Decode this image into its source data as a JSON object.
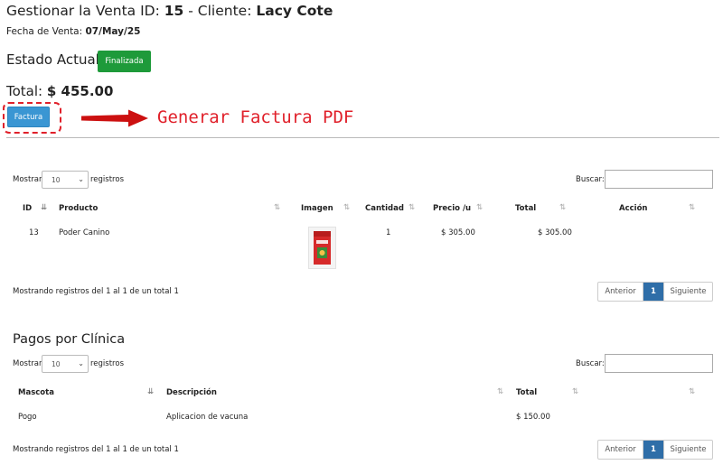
{
  "header": {
    "title_prefix": "Gestionar la Venta ID: ",
    "sale_id": "15",
    "title_mid": " - Cliente: ",
    "client": "Lacy Cote",
    "fecha_label": "Fecha de Venta: ",
    "fecha_value": "07/May/25",
    "estado_label": "Estado Actual:",
    "estado_value": "Finalizada",
    "total_label": "Total: ",
    "total_value": "$ 455.00",
    "factura_button": "Factura",
    "annotation": "Generar Factura PDF"
  },
  "sales_table": {
    "show_label": "Mostrar",
    "show_value": "10",
    "records_label": "registros",
    "search_label": "Buscar:",
    "columns": [
      "ID",
      "Producto",
      "Imagen",
      "Cantidad",
      "Precio /u",
      "Total",
      "Acción"
    ],
    "rows": [
      {
        "id": "13",
        "producto": "Poder Canino",
        "cantidad": "1",
        "precio": "$ 305.00",
        "total": "$ 305.00"
      }
    ],
    "info": "Mostrando registros del 1 al 1 de un total 1",
    "pager": {
      "prev": "Anterior",
      "current": "1",
      "next": "Siguiente"
    }
  },
  "payments": {
    "title": "Pagos por Clínica",
    "show_label": "Mostrar",
    "show_value": "10",
    "records_label": "registros",
    "search_label": "Buscar:",
    "columns": [
      "Mascota",
      "Descripción",
      "Total"
    ],
    "rows": [
      {
        "mascota": "Pogo",
        "descripcion": "Aplicacion de vacuna",
        "total": "$ 150.00"
      }
    ],
    "info": "Mostrando registros del 1 al 1 de un total 1",
    "pager": {
      "prev": "Anterior",
      "current": "1",
      "next": "Siguiente"
    }
  },
  "colors": {
    "badge": "#1e9a3a",
    "factura": "#3a96d3",
    "annotation": "#e0202a",
    "pager_active": "#2f6ea8"
  }
}
